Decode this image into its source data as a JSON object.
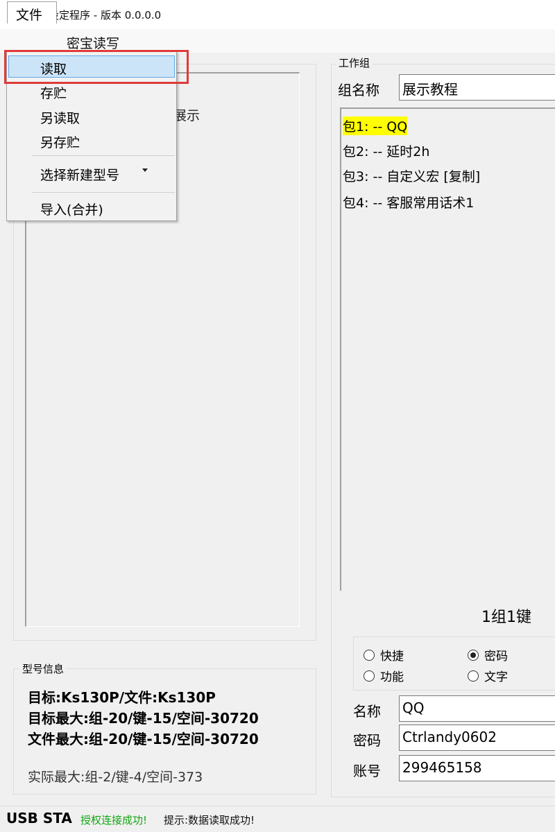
{
  "window": {
    "title": "蜜宝设定程序 - 版本 0.0.0.0"
  },
  "menubar": {
    "file": "文件",
    "read_write": "密宝读写"
  },
  "file_menu": {
    "items": [
      "读取",
      "存贮",
      "另读取",
      "另存贮"
    ],
    "select_model": "选择新建型号",
    "import": "导入(合并)"
  },
  "left_panel": {
    "tree_text": "展示"
  },
  "model_info": {
    "legend": "型号信息",
    "lines": [
      "目标:Ks130P/文件:Ks130P",
      "目标最大:组-20/键-15/空间-30720",
      "文件最大:组-20/键-15/空间-30720"
    ],
    "actual": "实际最大:组-2/键-4/空间-373"
  },
  "work_group": {
    "legend": "工作组",
    "name_label": "组名称",
    "name_value": "展示教程",
    "packages": [
      "包1: -- QQ",
      "包2: -- 延时2h",
      "包3: -- 自定义宏 [复制]",
      "包4: -- 客服常用话术1"
    ],
    "selected_index": 0,
    "key_info": "1组1键"
  },
  "radios": {
    "shortcut": "快捷",
    "password": "密码",
    "function": "功能",
    "text": "文字",
    "checked": "password"
  },
  "fields": {
    "name_label": "名称",
    "name_value": "QQ",
    "password_label": "密码",
    "password_value": "Ctrlandy0602",
    "account_label": "账号",
    "account_value": "299465158"
  },
  "status": {
    "usb": "USB STA",
    "auth": "授权连接成功!",
    "tip": "提示:数据读取成功!"
  },
  "colors": {
    "highlight": "#ffff00",
    "status_ok": "#11a611",
    "annotation_box": "#e03a3a",
    "menu_hover": "#cce4f7"
  }
}
